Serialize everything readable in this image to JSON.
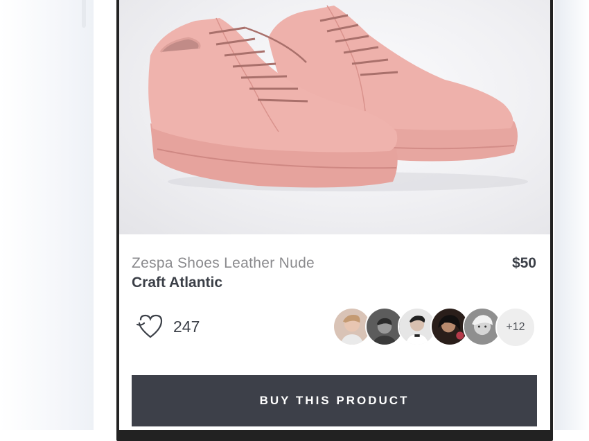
{
  "product": {
    "name": "Zespa Shoes Leather Nude",
    "brand": "Craft Atlantic",
    "price": "$50",
    "likes": "247",
    "extra_avatars": "+12",
    "buy_label": "BUY THIS PRODUCT"
  },
  "icons": {
    "like": "heart-outline-icon"
  },
  "colors": {
    "button": "#3d4049",
    "title": "#8a8a8d",
    "text_dark": "#3b3f47",
    "shoe": "#e9a8a3"
  }
}
